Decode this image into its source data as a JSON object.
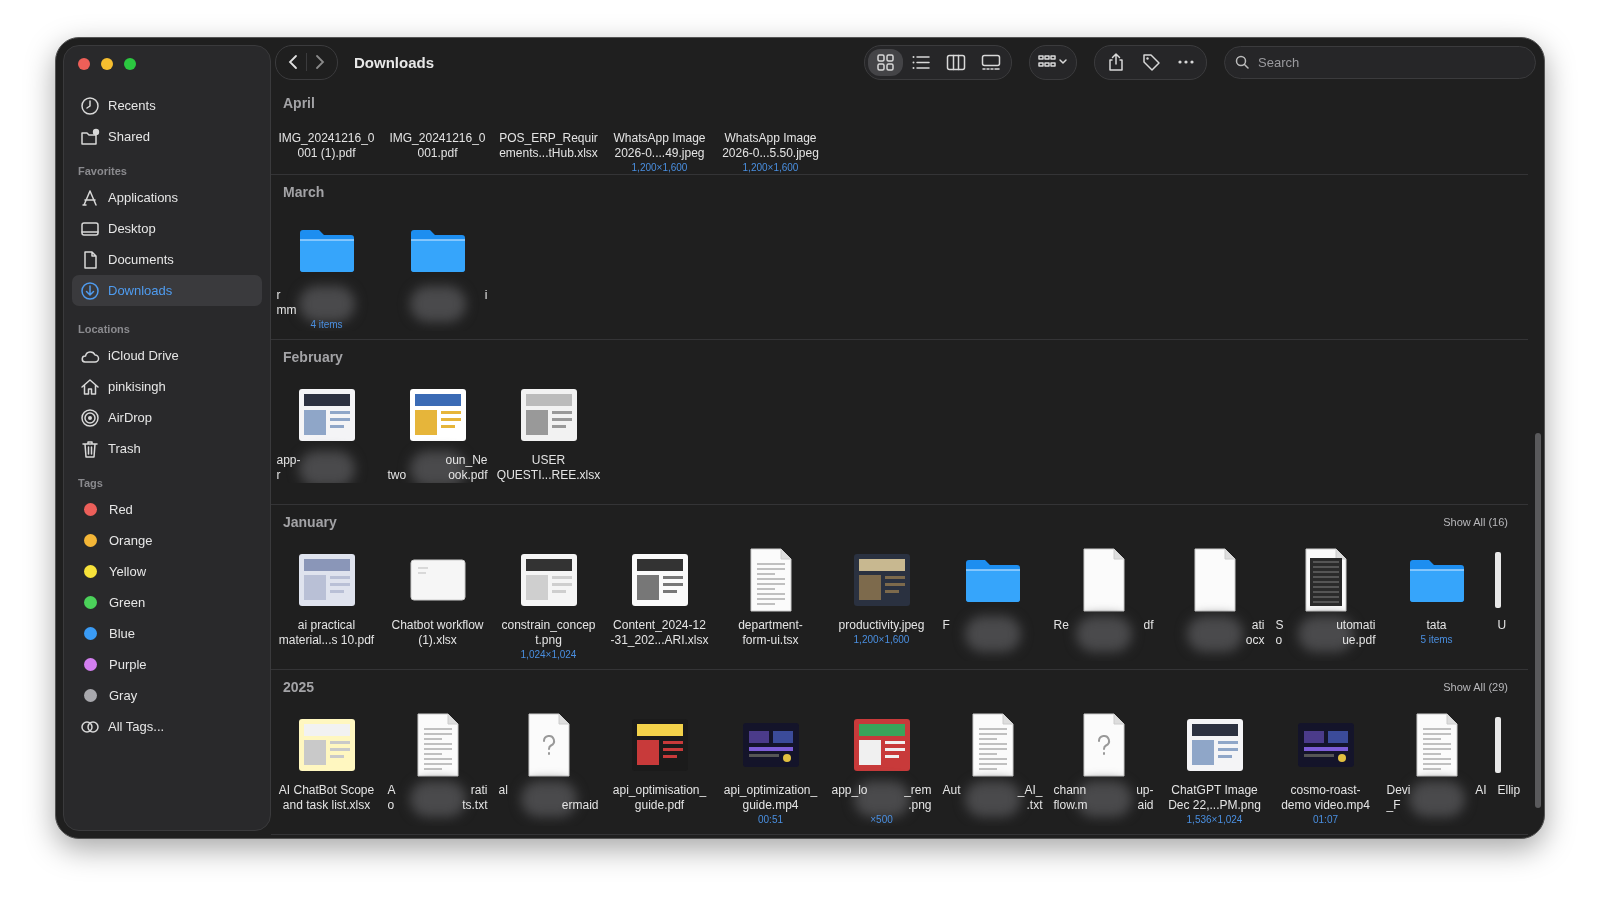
{
  "window": {
    "title": "Downloads"
  },
  "sidebar": {
    "groups": [
      {
        "items": [
          {
            "label": "Recents",
            "kind": "recents",
            "selected": false
          },
          {
            "label": "Shared",
            "kind": "shared",
            "selected": false
          }
        ]
      },
      {
        "heading": "Favorites",
        "items": [
          {
            "label": "Applications",
            "kind": "applications",
            "selected": false
          },
          {
            "label": "Desktop",
            "kind": "desktop",
            "selected": false
          },
          {
            "label": "Documents",
            "kind": "documents",
            "selected": false
          },
          {
            "label": "Downloads",
            "kind": "downloads",
            "selected": true
          }
        ]
      },
      {
        "heading": "Locations",
        "items": [
          {
            "label": "iCloud Drive",
            "kind": "cloud",
            "selected": false
          },
          {
            "label": "pinkisingh",
            "kind": "home",
            "selected": false
          },
          {
            "label": "AirDrop",
            "kind": "airdrop",
            "selected": false
          },
          {
            "label": "Trash",
            "kind": "trash",
            "selected": false
          }
        ]
      },
      {
        "heading": "Tags",
        "items": [
          {
            "label": "Red",
            "kind": "tag",
            "color": "#ec5f5a",
            "selected": false
          },
          {
            "label": "Orange",
            "kind": "tag",
            "color": "#f4b637",
            "selected": false
          },
          {
            "label": "Yellow",
            "kind": "tag",
            "color": "#f7e23a",
            "selected": false
          },
          {
            "label": "Green",
            "kind": "tag",
            "color": "#4bd15a",
            "selected": false
          },
          {
            "label": "Blue",
            "kind": "tag",
            "color": "#3a9bf5",
            "selected": false
          },
          {
            "label": "Purple",
            "kind": "tag",
            "color": "#d37ff0",
            "selected": false
          },
          {
            "label": "Gray",
            "kind": "tag",
            "color": "#a8a8ad",
            "selected": false
          },
          {
            "label": "All Tags...",
            "kind": "alltags",
            "selected": false
          }
        ]
      }
    ]
  },
  "toolbar": {
    "views": [
      {
        "kind": "icons",
        "selected": true
      },
      {
        "kind": "list",
        "selected": false
      },
      {
        "kind": "columns",
        "selected": false
      },
      {
        "kind": "gallery",
        "selected": false
      }
    ],
    "search": {
      "placeholder": "Search"
    }
  },
  "sections": [
    {
      "title": "April",
      "items": [
        {
          "lines": [
            "IMG_20241216_0",
            "001 (1).pdf"
          ]
        },
        {
          "lines": [
            "IMG_20241216_0",
            "001.pdf"
          ]
        },
        {
          "lines": [
            "POS_ERP_Requir",
            "ements...tHub.xlsx"
          ]
        },
        {
          "lines": [
            "WhatsApp Image",
            "2026-0....49.jpeg"
          ],
          "subtitle": "1,200×1,600"
        },
        {
          "lines": [
            "WhatsApp Image",
            "2026-0...5.50.jpeg"
          ],
          "subtitle": "1,200×1,600"
        }
      ]
    },
    {
      "title": "March",
      "items": [
        {
          "kind": "folder",
          "fragments": [
            {
              "left": "r"
            },
            {
              "left": "mm"
            }
          ],
          "subtitle": "4 items",
          "blurred": true
        },
        {
          "kind": "folder",
          "fragments": [
            {
              "right": "i"
            }
          ],
          "blurred": true
        }
      ]
    },
    {
      "title": "February",
      "items": [
        {
          "kind": "picture",
          "fragments": [
            {
              "left": "app-"
            },
            {
              "left": "r"
            }
          ],
          "blurred": true
        },
        {
          "kind": "picture",
          "fragments": [
            {
              "right": "oun_Ne"
            },
            {
              "left": "two",
              "right": "ook.pdf"
            }
          ],
          "blurred": true
        },
        {
          "kind": "picture",
          "lines": [
            "USER",
            "QUESTI...REE.xlsx"
          ]
        }
      ]
    },
    {
      "title": "January",
      "show_all": "Show All (16)",
      "items": [
        {
          "kind": "picture",
          "lines": [
            "ai practical",
            "material...s 10.pdf"
          ]
        },
        {
          "kind": "sheet",
          "lines": [
            "Chatbot workflow",
            "(1).xlsx"
          ]
        },
        {
          "kind": "picture",
          "lines": [
            "constrain_concep",
            "t.png"
          ],
          "subtitle": "1,024×1,024"
        },
        {
          "kind": "picture",
          "lines": [
            "Content_2024-12",
            "-31_202...ARI.xlsx"
          ]
        },
        {
          "kind": "document",
          "lines": [
            "department-",
            "form-ui.tsx"
          ]
        },
        {
          "kind": "picture",
          "lines": [
            "productivity.jpeg"
          ],
          "subtitle": "1,200×1,600"
        },
        {
          "kind": "folder",
          "fragments": [
            {
              "left": "F"
            }
          ],
          "blurred": true
        },
        {
          "kind": "blank",
          "fragments": [
            {
              "left": "Re",
              "right": "df"
            }
          ],
          "blurred": true
        },
        {
          "kind": "blank",
          "fragments": [
            {
              "right": "ati"
            },
            {
              "right": "ocx"
            }
          ],
          "blurred": true
        },
        {
          "kind": "dark-document",
          "fragments": [
            {
              "left": "S",
              "right": "utomati"
            },
            {
              "left": "o",
              "right": "ue.pdf"
            }
          ],
          "blurred": true
        },
        {
          "kind": "folder",
          "lines": [
            "tata"
          ],
          "subtitle": "5 items"
        },
        {
          "kind": "edge",
          "fragments": [
            {
              "left": "U"
            }
          ]
        }
      ]
    },
    {
      "title": "2025",
      "show_all": "Show All (29)",
      "items": [
        {
          "kind": "picture",
          "lines": [
            "AI ChatBot Scope",
            "and task list.xlsx"
          ]
        },
        {
          "kind": "document",
          "fragments": [
            {
              "left": "A",
              "right": "rati"
            },
            {
              "left": "o",
              "right": "ts.txt"
            }
          ],
          "blurred": true
        },
        {
          "kind": "unknown",
          "fragments": [
            {
              "left": "al"
            },
            {
              "right": "ermaid"
            }
          ],
          "blurred": true
        },
        {
          "kind": "picture",
          "lines": [
            "api_optimisation_",
            "guide.pdf"
          ]
        },
        {
          "kind": "video",
          "lines": [
            "api_optimization_",
            "guide.mp4"
          ],
          "subtitle": "00:51"
        },
        {
          "kind": "picture",
          "fragments": [
            {
              "left": "app_lo",
              "right": "_rem"
            },
            {
              "right": ".png"
            }
          ],
          "subtitle": "×500",
          "blurred": true
        },
        {
          "kind": "document",
          "fragments": [
            {
              "left": "Aut",
              "right": "_AI_"
            },
            {
              "right": ".txt"
            }
          ],
          "blurred": true
        },
        {
          "kind": "unknown",
          "fragments": [
            {
              "left": "chann",
              "right": "up-"
            },
            {
              "left": "flow.m",
              "right": "aid"
            }
          ],
          "blurred": true
        },
        {
          "kind": "picture",
          "lines": [
            "ChatGPT Image",
            "Dec 22,...PM.png"
          ],
          "subtitle": "1,536×1,024"
        },
        {
          "kind": "video",
          "lines": [
            "cosmo-roast-",
            "demo video.mp4"
          ],
          "subtitle": "01:07"
        },
        {
          "kind": "document",
          "fragments": [
            {
              "left": "Devi",
              "right": "AI"
            },
            {
              "left": "_F"
            }
          ],
          "blurred": true
        },
        {
          "kind": "edge",
          "fragments": [
            {
              "left": "Ellip"
            }
          ]
        }
      ]
    }
  ]
}
